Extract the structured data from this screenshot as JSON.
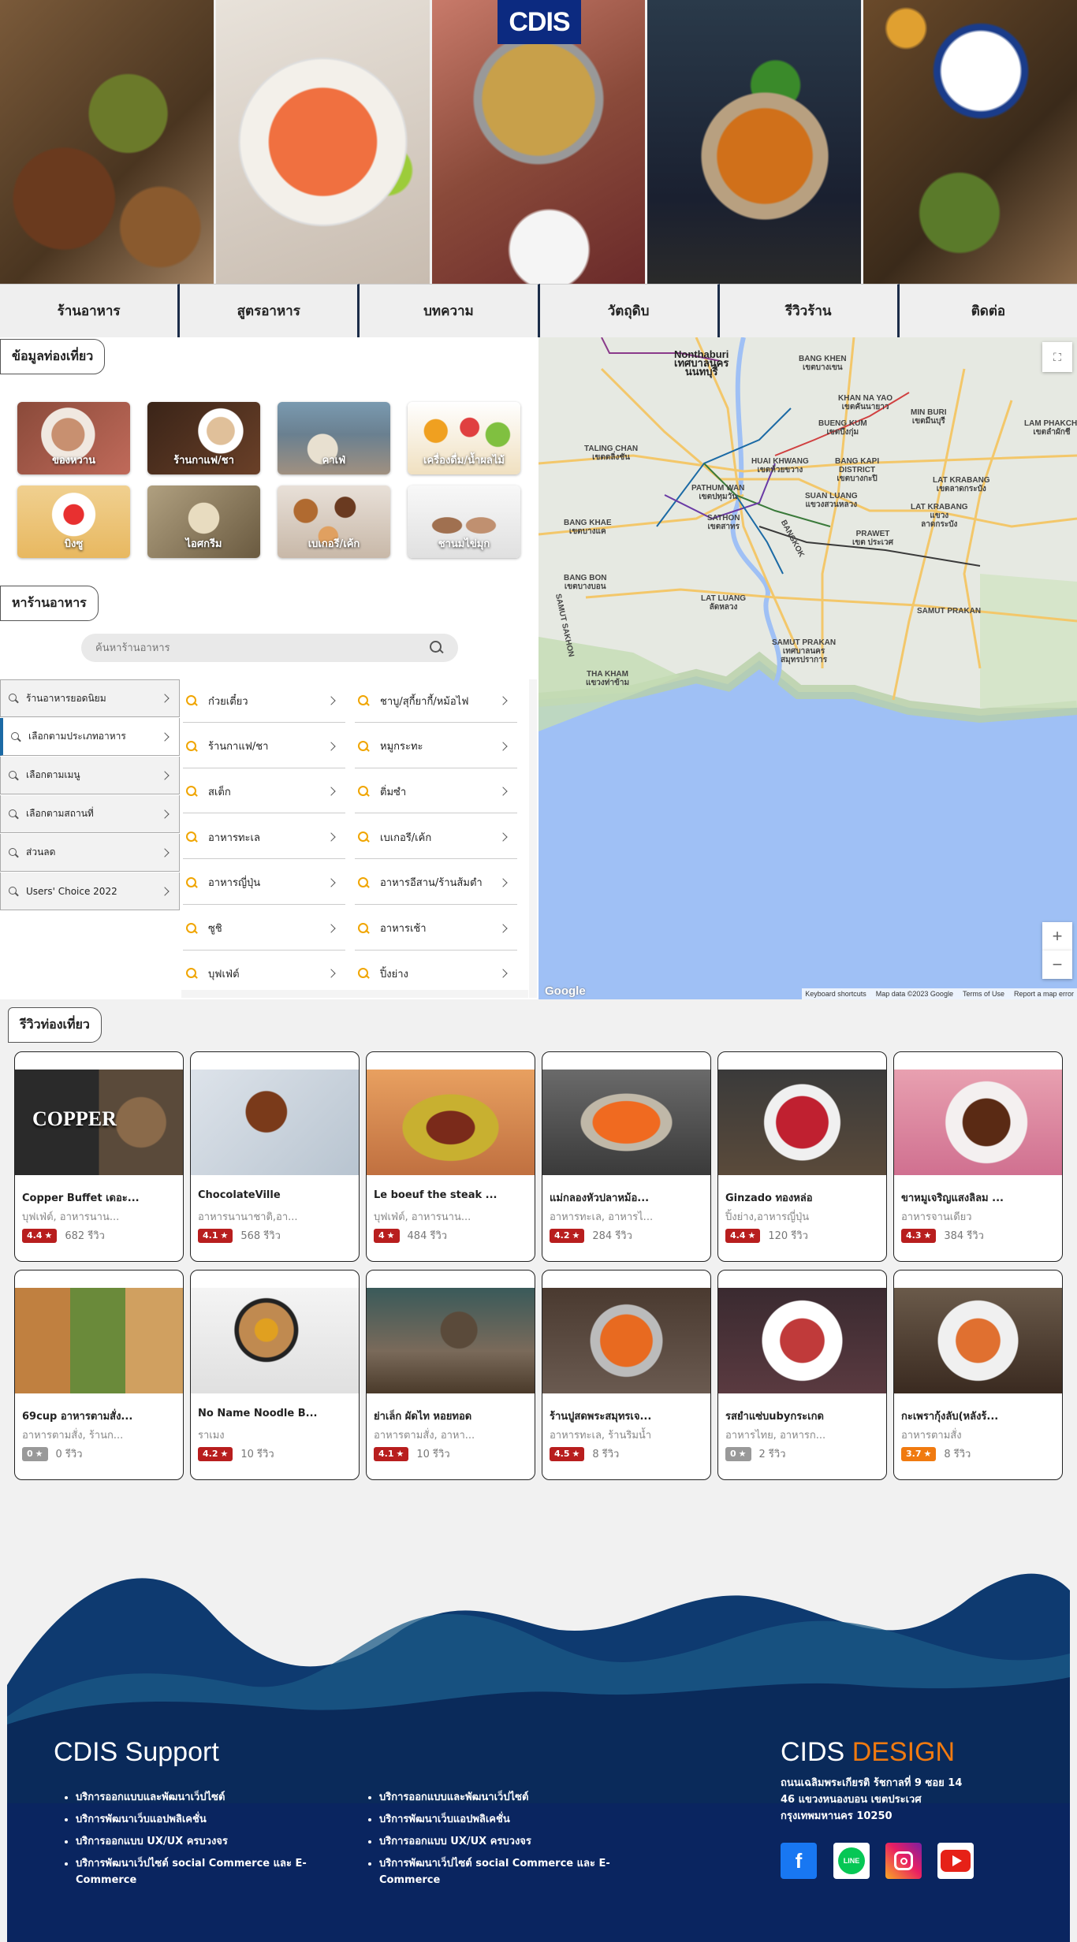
{
  "logo": {
    "text": "CDIS"
  },
  "nav": [
    "ร้านอาหาร",
    "สูตรอาหาร",
    "บทความ",
    "วัตถุดิบ",
    "รีวิวร้าน",
    "ติดต่อ"
  ],
  "travel_info": {
    "label": "ข้อมูลท่องเที่ยว"
  },
  "categories": [
    "ของหวาน",
    "ร้านกาแฟ/ชา",
    "คาเฟ่",
    "เครื่องดื่ม/น้ำผลไม้",
    "บิงซู",
    "ไอศกรีม",
    "เบเกอรี/เค้ก",
    "ชานมไข่มุก"
  ],
  "find_restaurant": {
    "label": "หาร้านอาหาร",
    "search_placeholder": "ค้นหาร้านอาหาร"
  },
  "side_menu": [
    "ร้านอาหารยอดนิยม",
    "เลือกตามประเภทอาหาร",
    "เลือกตามเมนู",
    "เลือกตามสถานที่",
    "ส่วนลด",
    "Users' Choice 2022"
  ],
  "sub_list": [
    "ก๋วยเตี๋ยว",
    "ชาบู/สุกี้ยากี้/หม้อไฟ",
    "ร้านกาแฟ/ชา",
    "หมูกระทะ",
    "สเต็ก",
    "ติ่มซำ",
    "อาหารทะเล",
    "เบเกอรี/เค้ก",
    "อาหารญี่ปุ่น",
    "อาหารอีสาน/ร้านส้มตำ",
    "ซูชิ",
    "อาหารเช้า",
    "บุฟเฟ่ต์",
    "ปิ้งย่าง"
  ],
  "map": {
    "labels": {
      "nonthaburi": "Nonthaburi\nเทศบาลนคร\nนนทบุรี",
      "bang_khen": "BANG KHEN\nเขตบางเขน",
      "khan_na_yao": "KHAN NA YAO\nเขตคันนายาว",
      "min_buri": "MIN BURI\nเขตมีนบุรี",
      "lam_phakchi": "LAM PHAKCHI\nเขตลำผักชี",
      "bueng_kum": "BUENG KUM\nเขตบึงกุ่ม",
      "taling_chan": "TALING CHAN\nเขตตลิ่งชัน",
      "huai_khwang": "HUAI KHWANG\nเขตห้วยขวาง",
      "bang_kapi": "BANG KAPI\nDISTRICT\nเขตบางกะปิ",
      "lat_krabang": "LAT KRABANG\nเขตลาดกระบัง",
      "pathum_wan": "PATHUM WAN\nเขตปทุมวัน",
      "suan_luang": "SUAN LUANG\nแขวงสวนหลวง",
      "lat_krabang2": "LAT KRABANG\nแขวง\nลาดกระบัง",
      "sathon": "SATHON\nเขตสาทร",
      "prawet": "PRAWET\nเขต ประเวศ",
      "bang_khae": "BANG KHAE\nเขตบางแค",
      "bang_bon": "BANG BON\nเขตบางบอน",
      "lat_luang": "Lat Luang\nลัดหลวง",
      "samut_prakan": "SAMUT PRAKAN",
      "samut_prakan_town": "Samut Prakan\nเทศบาลนคร\nสมุทรปราการ",
      "tha_kham": "THA KHAM\nแขวงท่าข้าม",
      "bangkok": "BANGKOK",
      "samut_sakhon": "SAMUT SAKHON"
    },
    "zoom_in": "+",
    "zoom_out": "−",
    "google": "Google",
    "footer": [
      "Keyboard shortcuts",
      "Map data ©2023 Google",
      "Terms of Use",
      "Report a map error"
    ]
  },
  "reviews": {
    "label": "รีวิวท่องเที่ยว",
    "cards": [
      {
        "name": "Copper Buffet เดอะ...",
        "type": "บุฟเฟ่ต์, อาหารนาน...",
        "rating": "4.4",
        "reviews": "682 รีวิว",
        "badge": "red",
        "img_text": "COPPER"
      },
      {
        "name": "ChocolateVille",
        "type": "อาหารนานาชาติ,อา...",
        "rating": "4.1",
        "reviews": "568 รีวิว",
        "badge": "red",
        "img_text": ""
      },
      {
        "name": "Le boeuf the steak ...",
        "type": "บุฟเฟ่ต์, อาหารนาน...",
        "rating": "4",
        "reviews": "484 รีวิว",
        "badge": "red",
        "img_text": ""
      },
      {
        "name": "แม่กลองหัวปลาหม้อ...",
        "type": "อาหารทะเล, อาหารไ...",
        "rating": "4.2",
        "reviews": "284 รีวิว",
        "badge": "red",
        "img_text": ""
      },
      {
        "name": "Ginzado ทองหล่อ",
        "type": "ปิ้งย่าง,อาหารญี่ปุ่น",
        "rating": "4.4",
        "reviews": "120 รีวิว",
        "badge": "red",
        "img_text": ""
      },
      {
        "name": "ขาหมูเจริญแสงลิลม ...",
        "type": "อาหารจานเดียว",
        "rating": "4.3",
        "reviews": "384 รีวิว",
        "badge": "red",
        "img_text": ""
      },
      {
        "name": "69cup อาหารตามสั่ง...",
        "type": "อาหารตามสั่ง, ร้านก...",
        "rating": "0",
        "reviews": "0 รีวิว",
        "badge": "gray",
        "img_text": ""
      },
      {
        "name": "No Name Noodle B...",
        "type": "ราเมง",
        "rating": "4.2",
        "reviews": "10 รีวิว",
        "badge": "red",
        "img_text": ""
      },
      {
        "name": "ย่าเล็ก ผัดไท หอยทอด",
        "type": "อาหารตามสั่ง, อาหา...",
        "rating": "4.1",
        "reviews": "10 รีวิว",
        "badge": "red",
        "img_text": ""
      },
      {
        "name": "ร้านปูสดพระสมุทรเจ...",
        "type": "อาหารทะเล, ร้านริมน้ำ",
        "rating": "4.5",
        "reviews": "8 รีวิว",
        "badge": "red",
        "img_text": ""
      },
      {
        "name": "รสยำแซ่บubyกระเกด",
        "type": "อาหารไทย, อาหารก...",
        "rating": "0",
        "reviews": "2 รีวิว",
        "badge": "gray",
        "img_text": ""
      },
      {
        "name": "กะเพรากุ้งลับ(หลังร้...",
        "type": "อาหารตามสั่ง",
        "rating": "3.7",
        "reviews": "8 รีวิว",
        "badge": "orange",
        "img_text": ""
      }
    ]
  },
  "footer": {
    "support_title": "CDIS Support",
    "col1": [
      "บริการออกแบบและพัฒนาเว็ปไซต์",
      "บริการพัฒนาเว็บแอปพลิเคชั่น",
      "บริการออกแบบ UX/UX ครบวงจร",
      "บริการพัฒนาเว็ปไซต์ social Commerce และ E-Commerce"
    ],
    "col2": [
      "บริการออกแบบและพัฒนาเว็ปไซต์",
      "บริการพัฒนาเว็บแอปพลิเคชั่น",
      "บริการออกแบบ UX/UX ครบวงจร",
      "บริการพัฒนาเว็ปไซต์ social Commerce และ E-Commerce"
    ],
    "brand_a": "CIDS",
    "brand_b": "DESIGN",
    "address": [
      "ถนนเฉลิมพระเกียรติ ร้ชกาลที่ 9 ซอย 14",
      "46 แขวงหนองบอน เขตประเวศ",
      "กรุงเทพมหานคร 10250"
    ],
    "social": [
      "facebook-icon",
      "line-icon",
      "instagram-icon",
      "youtube-icon"
    ]
  }
}
